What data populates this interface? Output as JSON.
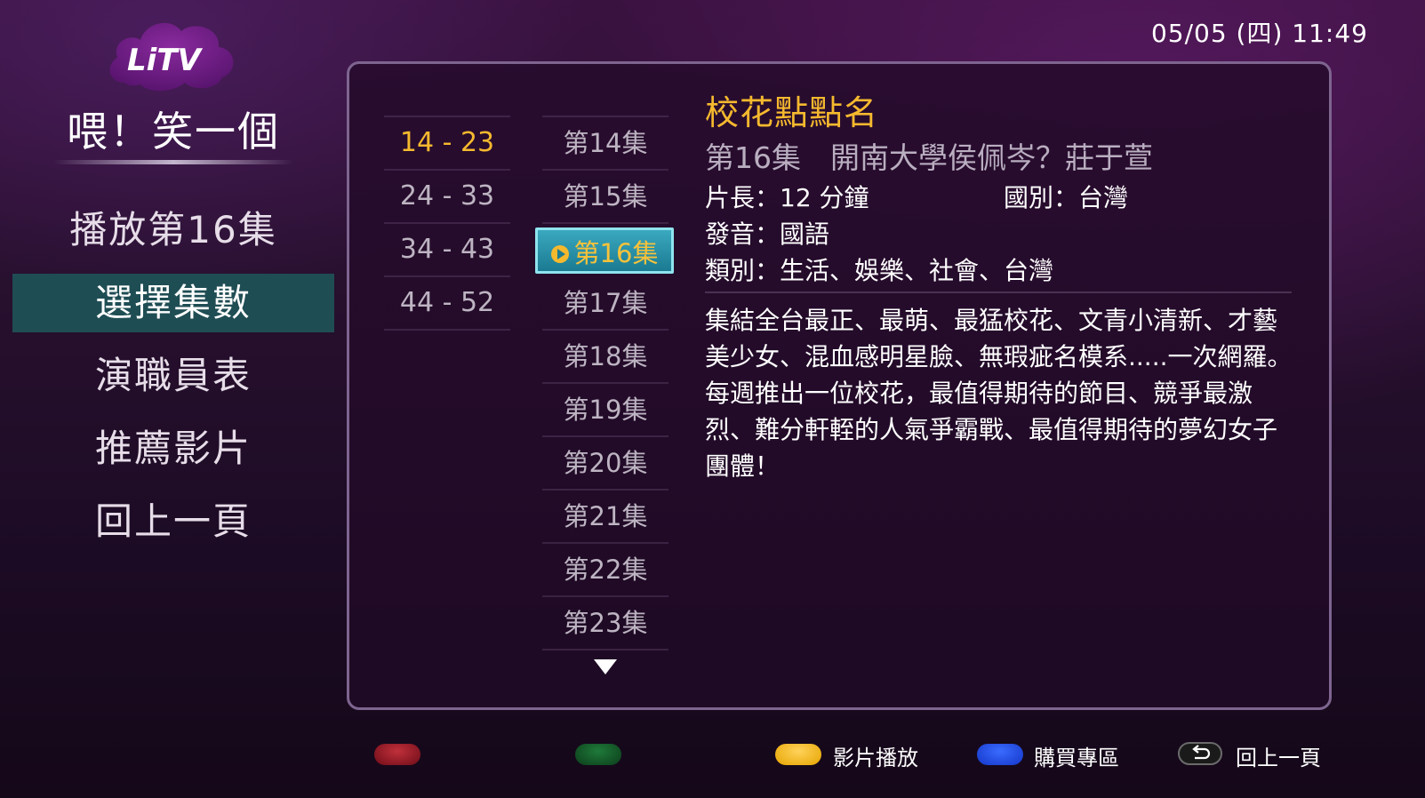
{
  "header": {
    "logo_text": "LiTV",
    "show_title": "喂！笑一個",
    "clock": "05/05 (四) 11:49"
  },
  "sidebar": {
    "items": [
      {
        "label": "播放第16集",
        "active": false
      },
      {
        "label": "選擇集數",
        "active": true
      },
      {
        "label": "演職員表",
        "active": false
      },
      {
        "label": "推薦影片",
        "active": false
      },
      {
        "label": "回上一頁",
        "active": false
      }
    ]
  },
  "ranges": [
    {
      "label": "14 - 23",
      "active": true
    },
    {
      "label": "24 - 33",
      "active": false
    },
    {
      "label": "34 - 43",
      "active": false
    },
    {
      "label": "44 - 52",
      "active": false
    }
  ],
  "episodes": [
    {
      "label": "第14集"
    },
    {
      "label": "第15集"
    },
    {
      "label": "第16集",
      "selected": true
    },
    {
      "label": "第17集"
    },
    {
      "label": "第18集"
    },
    {
      "label": "第19集"
    },
    {
      "label": "第20集"
    },
    {
      "label": "第21集"
    },
    {
      "label": "第22集"
    },
    {
      "label": "第23集"
    }
  ],
  "detail": {
    "title": "校花點點名",
    "episode_line": "第16集　開南大學侯佩岑？莊于萱",
    "length": "片長：12 分鐘",
    "country": "國別：台灣",
    "audio": "發音：國語",
    "category": "類別：生活、娛樂、社會、台灣",
    "description": "集結全台最正、最萌、最猛校花、文青小清新、才藝美少女、混血感明星臉、無瑕疵名模系.....一次網羅。每週推出一位校花，最值得期待的節目、競爭最激烈、難分軒輊的人氣爭霸戰、最值得期待的夢幻女子團體！"
  },
  "footer": {
    "yellow_label": "影片播放",
    "blue_label": "購買專區",
    "back_label": "回上一頁"
  },
  "colors": {
    "accent_yellow": "#f5b92e",
    "selected_teal": "#1f4d54",
    "episode_highlight": "#3aa9c0",
    "red_key": "#c0303a",
    "green_key": "#1f7a3a",
    "yellow_key": "#ffd25a",
    "blue_key": "#3a6cff"
  }
}
